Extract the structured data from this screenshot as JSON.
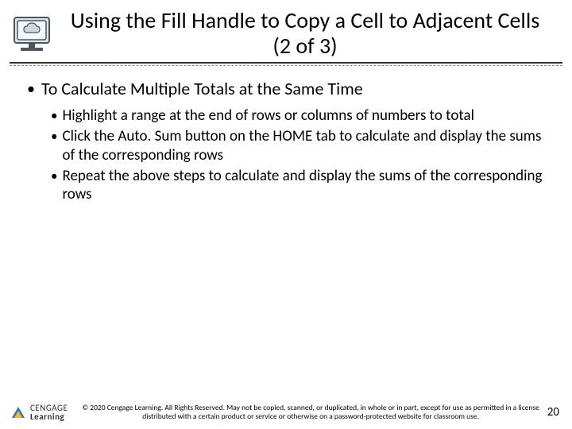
{
  "title": "Using the Fill Handle to Copy a Cell to Adjacent Cells (2 of 3)",
  "section_heading": "To Calculate Multiple Totals at the Same Time",
  "bullets": {
    "b1": "Highlight a range at the end of rows or columns of numbers to total",
    "b2": "Click the Auto. Sum button on the HOME tab to calculate and display the sums of the corresponding rows",
    "b3": "Repeat the above steps to calculate and display the sums of the corresponding rows"
  },
  "logo": {
    "line1": "CENGAGE",
    "line2": "Learning"
  },
  "copyright": "© 2020 Cengage Learning. All Rights Reserved. May not be copied, scanned, or duplicated, in whole or in part, except for use as permitted in a license distributed with a certain product or service or otherwise on a password-protected website for classroom use.",
  "page_number": "20"
}
